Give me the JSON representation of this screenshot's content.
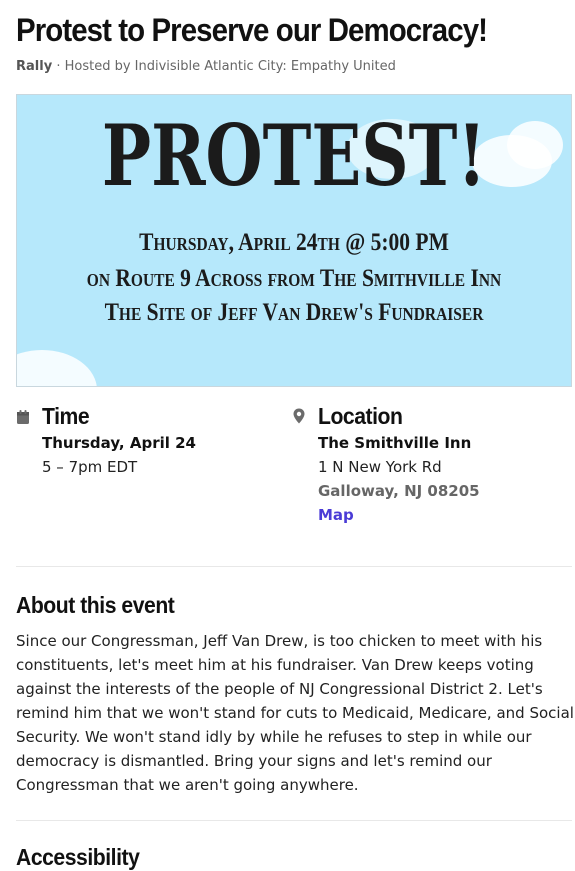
{
  "event": {
    "title": "Protest to Preserve our Democracy!",
    "type": "Rally",
    "separator": "·",
    "host": "Hosted by Indivisible Atlantic City: Empathy United"
  },
  "banner": {
    "headline": "PROTEST!",
    "line1": "Thursday, April 24th @ 5:00 PM",
    "line2": "on Route 9 Across from The Smithville Inn",
    "line3": "The Site of Jeff Van Drew's Fundraiser",
    "background_color": "#b6e8fb"
  },
  "time": {
    "heading": "Time",
    "icon": "calendar-icon",
    "date": "Thursday, April 24",
    "hours": "5 – 7pm EDT"
  },
  "location": {
    "heading": "Location",
    "icon": "map-pin-icon",
    "venue": "The Smithville Inn",
    "street": "1 N New York Rd",
    "city": "Galloway, NJ 08205",
    "map_link": "Map",
    "link_color": "#4a3bd6"
  },
  "about": {
    "heading": "About this event",
    "body": "Since our Congressman, Jeff Van Drew, is too chicken to meet with his constituents, let's meet him at his fundraiser. Van Drew keeps voting against the interests of the people of NJ Congressional District 2. Let's remind him that we won't stand for cuts to Medicaid, Medicare, and Social Security. We won't stand idly by while he refuses to step in while our democracy is dismantled. Bring your signs and let's remind our Congressman that we aren't going anywhere."
  },
  "accessibility": {
    "heading": "Accessibility"
  }
}
